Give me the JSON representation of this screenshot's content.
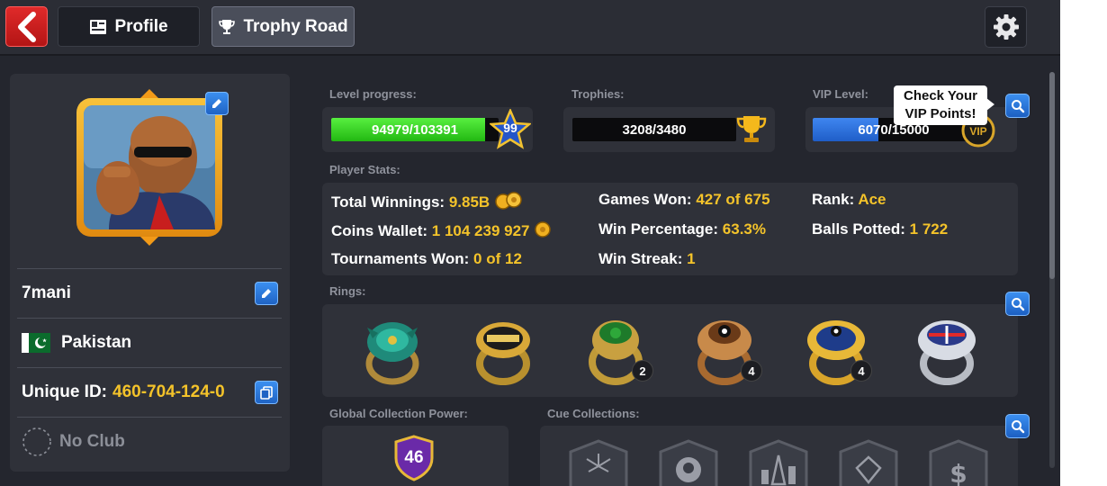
{
  "header": {
    "back_icon": "chevron-left-icon",
    "tabs": [
      {
        "label": "Profile",
        "icon": "profile-card-icon",
        "active": false
      },
      {
        "label": "Trophy Road",
        "icon": "trophy-icon",
        "active": true
      }
    ],
    "settings_icon": "gear-icon"
  },
  "player": {
    "name": "7mani",
    "country": "Pakistan",
    "unique_id_label": "Unique ID:",
    "unique_id": "460-704-124-0",
    "club": "No Club"
  },
  "progress": {
    "level_label": "Level progress:",
    "level_text": "94979/103391",
    "level_fraction": 0.919,
    "level": "99",
    "trophies_label": "Trophies:",
    "trophies_text": "3208/3480",
    "trophies_fraction": 0,
    "vip_label": "VIP Level:",
    "vip_text": "6070/15000",
    "vip_fraction": 0.405,
    "vip_tooltip_line1": "Check Your",
    "vip_tooltip_line2": "VIP Points!"
  },
  "stats": {
    "section_label": "Player Stats:",
    "total_winnings_label": "Total Winnings:",
    "total_winnings": "9.85B",
    "coins_wallet_label": "Coins Wallet:",
    "coins_wallet": "1 104 239 927",
    "tournaments_won_label": "Tournaments Won:",
    "tournaments_won": "0 of 12",
    "games_won_label": "Games Won:",
    "games_won": "427 of 675",
    "win_percentage_label": "Win Percentage:",
    "win_percentage": "63.3%",
    "win_streak_label": "Win Streak:",
    "win_streak": "1",
    "rank_label": "Rank:",
    "rank": "Ace",
    "balls_potted_label": "Balls Potted:",
    "balls_potted": "1 722"
  },
  "rings": {
    "section_label": "Rings:",
    "items": [
      {
        "name": "dragon-ring",
        "count": ""
      },
      {
        "name": "champions-ring",
        "count": ""
      },
      {
        "name": "legend-green-ring",
        "count": "2"
      },
      {
        "name": "eight-ball-bronze-ring",
        "count": "4"
      },
      {
        "name": "blue-gold-ring",
        "count": "4"
      },
      {
        "name": "silver-flag-ring",
        "count": ""
      }
    ]
  },
  "collection": {
    "global_power_label": "Global Collection Power:",
    "global_power": "46",
    "cue_label": "Cue Collections:"
  },
  "colors": {
    "accent_blue": "#2f7de0",
    "level_green": "#33d41c",
    "vip_blue": "#2d6fd8",
    "highlight_yellow": "#f4c32a",
    "back_red": "#d81e1e"
  }
}
